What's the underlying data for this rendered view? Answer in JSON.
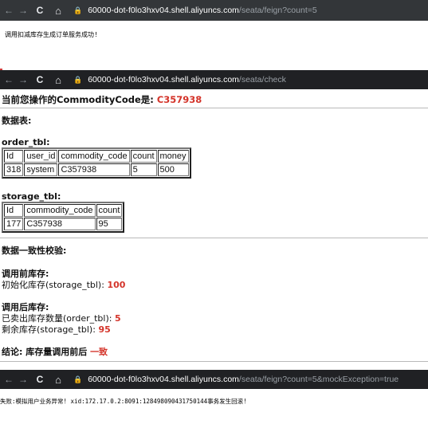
{
  "bars": {
    "bar1": {
      "host": "60000-dot-f0lo3hxv04.shell.aliyuncs.com",
      "path": "/seata/feign?count=5"
    },
    "bar2": {
      "host": "60000-dot-f0lo3hxv04.shell.aliyuncs.com",
      "path": "/seata/check"
    },
    "bar3": {
      "host": "60000-dot-f0lo3hxv04.shell.aliyuncs.com",
      "path": "/seata/feign?count=5&mockException=true"
    }
  },
  "icons": {
    "back": "←",
    "forward": "→",
    "reload": "C",
    "home": "⌂",
    "lock": "🔒"
  },
  "success_msg": "调用扣减库存生成订单服务成功!",
  "check": {
    "heading_label": "当前您操作的CommodityCode是: ",
    "heading_value": "C357938",
    "data_table_label": "数据表:",
    "order_label": "order_tbl:",
    "order_headers": [
      "Id",
      "user_id",
      "commodity_code",
      "count",
      "money"
    ],
    "order_row": [
      "318",
      "system",
      "C357938",
      "5",
      "500"
    ],
    "storage_label": "storage_tbl:",
    "storage_headers": [
      "Id",
      "commodity_code",
      "count"
    ],
    "storage_row": [
      "177",
      "C357938",
      "95"
    ],
    "consistency_label": "数据一致性校验:",
    "before_label": "调用前库存:",
    "init_stock_label": "初始化库存(storage_tbl): ",
    "init_stock_value": "100",
    "after_label": "调用后库存:",
    "sold_label": "已卖出库存数量(order_tbl): ",
    "sold_value": "5",
    "remain_label": "剩余库存(storage_tbl): ",
    "remain_value": "95",
    "conclusion_label": "结论: 库存量调用前后 ",
    "conclusion_value": "一致"
  },
  "fail_msg": "失败:模拟用户业务异常! xid:172.17.0.2:8091:128498090431750144事务发生回滚!",
  "colors": {
    "accent_red": "#d4342a",
    "bar_bg": "#202124"
  }
}
